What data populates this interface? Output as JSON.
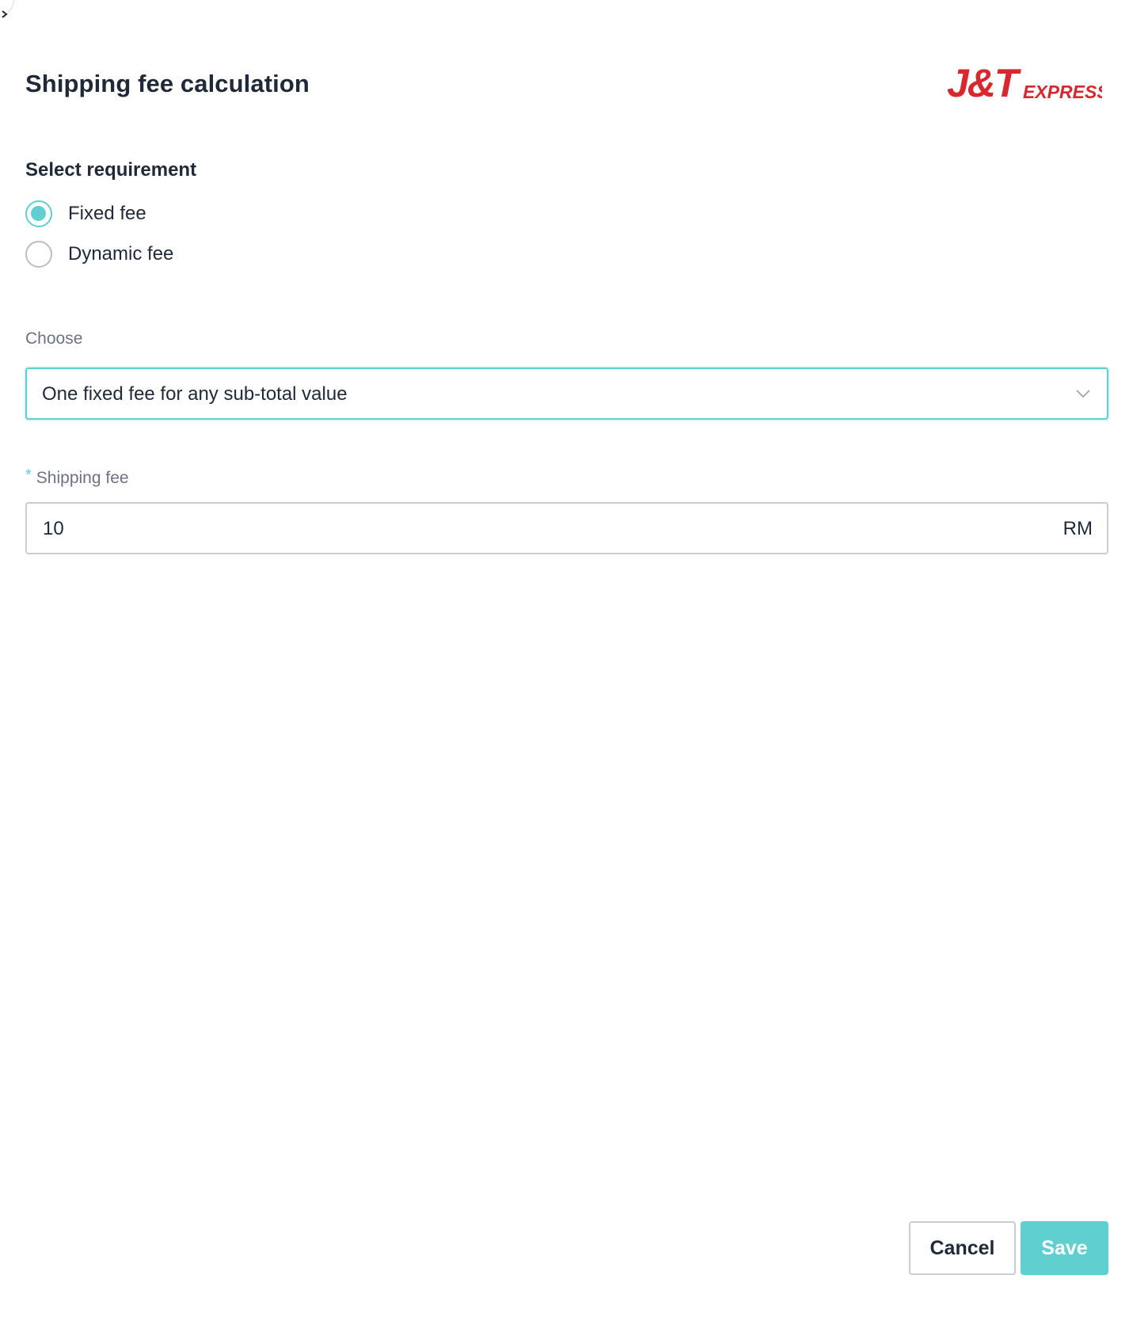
{
  "header": {
    "title": "Shipping fee calculation",
    "logo": {
      "text_primary": "J&T",
      "text_secondary": "EXPRESS",
      "color": "#d7282f"
    }
  },
  "requirement": {
    "label": "Select requirement",
    "options": [
      {
        "label": "Fixed fee",
        "checked": true
      },
      {
        "label": "Dynamic fee",
        "checked": false
      }
    ]
  },
  "choose": {
    "label": "Choose",
    "selected_value": "One fixed fee for any sub-total value"
  },
  "shipping_fee": {
    "required_marker": "*",
    "label": "Shipping fee",
    "value": "10",
    "suffix": "RM"
  },
  "actions": {
    "cancel_label": "Cancel",
    "save_label": "Save"
  },
  "colors": {
    "accent": "#5fcfcf",
    "text": "#1f2937",
    "muted": "#6b7280",
    "border": "#c9cdd2"
  }
}
